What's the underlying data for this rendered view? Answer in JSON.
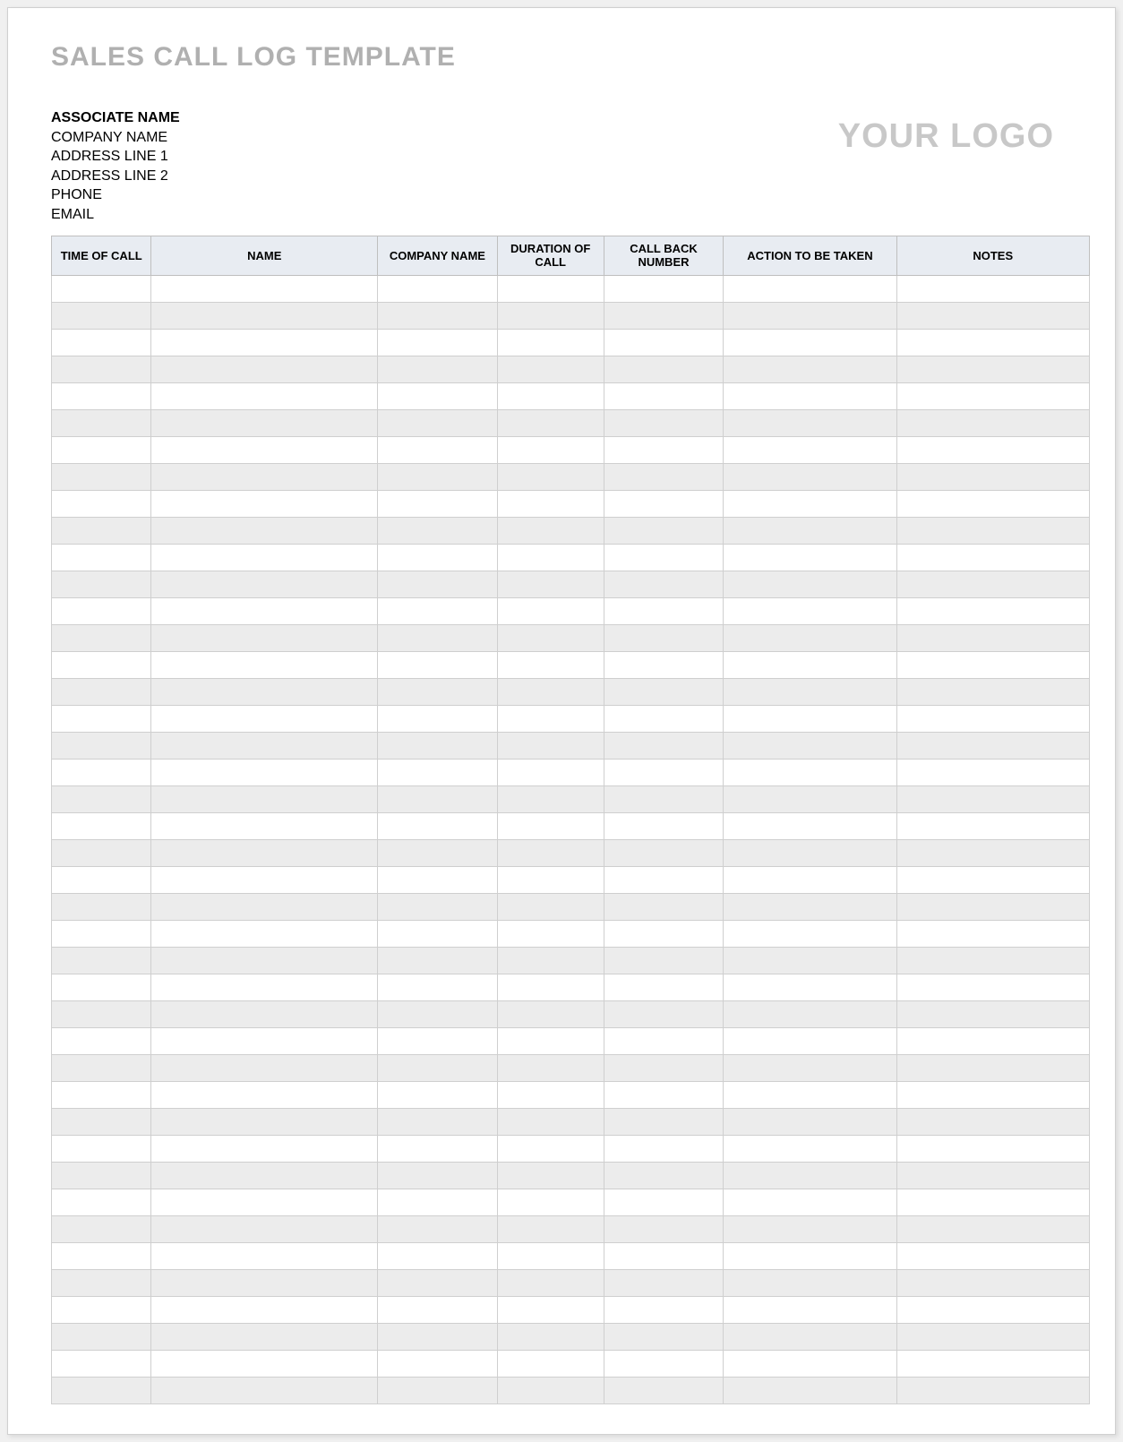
{
  "title": "SALES CALL LOG TEMPLATE",
  "associate": {
    "name_label": "ASSOCIATE NAME",
    "company_label": "COMPANY NAME",
    "address1_label": "ADDRESS LINE 1",
    "address2_label": "ADDRESS LINE 2",
    "phone_label": "PHONE",
    "email_label": "EMAIL"
  },
  "logo_text": "YOUR LOGO",
  "columns": {
    "time": "TIME OF CALL",
    "name": "NAME",
    "company": "COMPANY NAME",
    "duration": "DURATION OF CALL",
    "callback": "CALL BACK NUMBER",
    "action": "ACTION TO BE TAKEN",
    "notes": "NOTES"
  },
  "row_count": 42
}
